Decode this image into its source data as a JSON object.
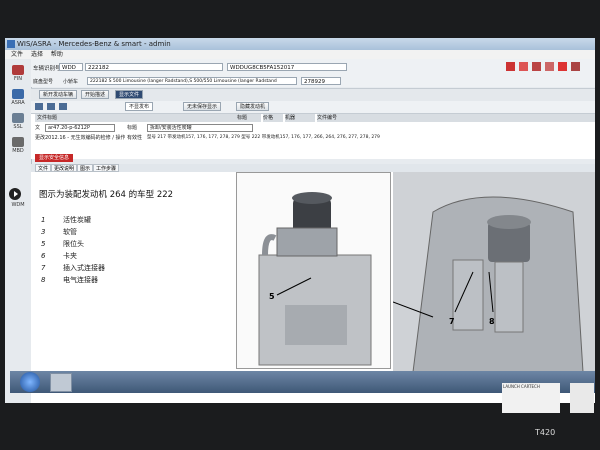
{
  "window": {
    "title": "WIS/ASRA - Mercedes-Benz & smart - admin"
  },
  "menu": [
    "文件",
    "选择",
    "帮助"
  ],
  "leftnav": [
    {
      "label": "FIN"
    },
    {
      "label": "ASRA"
    },
    {
      "label": "SSL"
    },
    {
      "label": "MBD"
    }
  ],
  "vehicle_row": {
    "label": "车辆识别号",
    "type_select": "WDD",
    "vin_value": "222182",
    "fin_value": "WDDUG8CB5FA152017",
    "model_label": "底盘型号",
    "model_value": "小轿车",
    "model_desc": "222182 S 500 Limousine (langer Radstand),S 500/550 Limousine (langer Radstand",
    "engine": "278929"
  },
  "toolbar_buttons": [
    "新开发动车辆",
    "开始描述",
    "显示文件"
  ],
  "filter_bar": {
    "select_value": "不显发布",
    "check1": "无未保存显示",
    "check2": "隐藏发动机"
  },
  "doc_grid": {
    "headers": [
      "文件标题",
      "标题",
      "价格",
      "机器",
      "文件编号"
    ],
    "rows": [
      {
        "label": "文",
        "value": "ar47.20-p-6212P",
        "title_label": "标题",
        "title_value": "拆卸/安装活性炭罐"
      },
      {
        "label": "更改",
        "value": "2012.16 - 无生效编码的检修 / 操作员",
        "extra_label": "有效性",
        "extra_value": "型号 217 带发动机157, 176, 177, 278, 279 型号 222 带发动机157, 176, 177, 266, 264, 276, 277, 278, 279"
      }
    ]
  },
  "safety_tab": "显示安全信息",
  "tabs": [
    "文件",
    "更改说明",
    "图示",
    "工作步骤"
  ],
  "document": {
    "title": "图示为装配发动机 264 的车型 222",
    "legend": [
      {
        "num": "1",
        "text": "活性炭罐"
      },
      {
        "num": "3",
        "text": "软管"
      },
      {
        "num": "5",
        "text": "限位头"
      },
      {
        "num": "6",
        "text": "卡夹"
      },
      {
        "num": "7",
        "text": "插入式连接器"
      },
      {
        "num": "8",
        "text": "电气连接器"
      }
    ],
    "callouts": {
      "img1": "5",
      "img2a": "7",
      "img2b": "8"
    }
  },
  "wdm_label": "WDM",
  "model": "T420",
  "sticker_text": "LAUNCH CARTECH"
}
